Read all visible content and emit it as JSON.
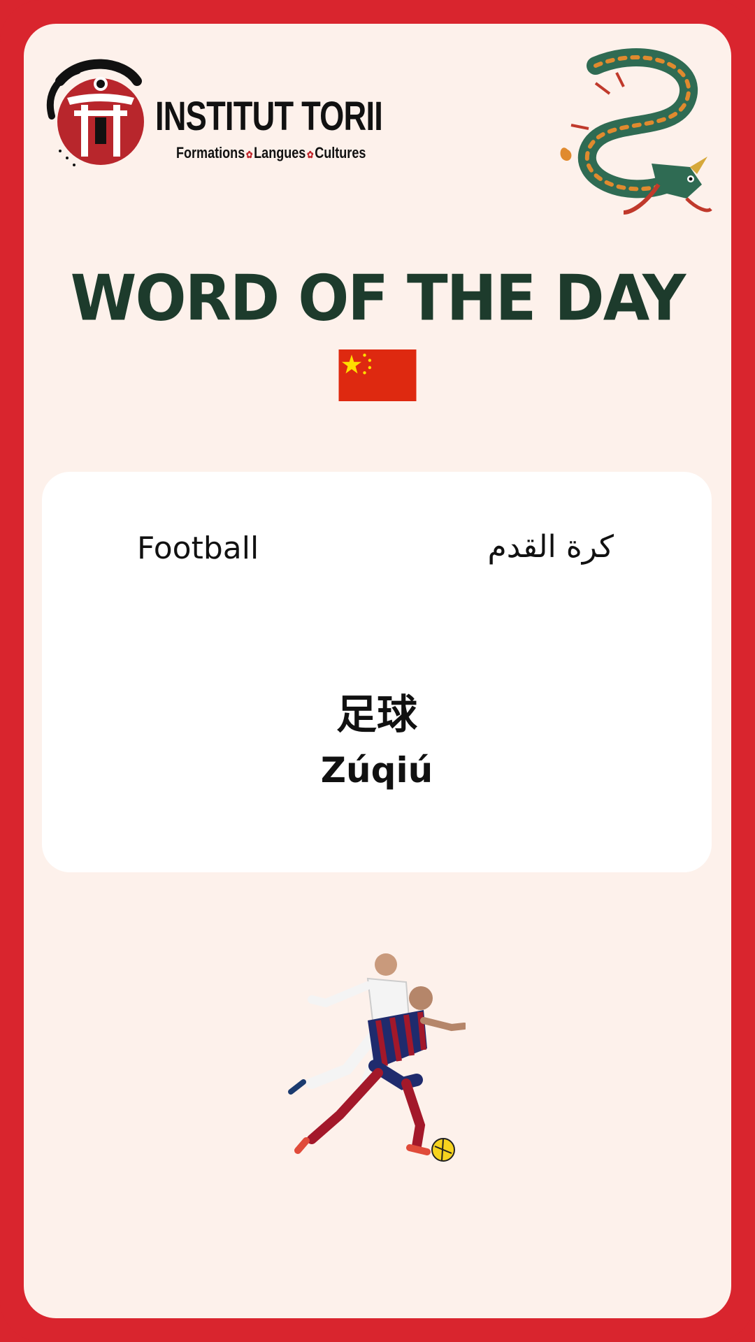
{
  "logo": {
    "title": "INSTITUT TORII",
    "subtitle_parts": [
      "Formations",
      "Langues",
      "Cultures"
    ]
  },
  "headline": "WORD OF THE DAY",
  "flag": "china-flag",
  "card": {
    "english": "Football",
    "arabic": "كرة القدم",
    "chinese": "足球",
    "pinyin": "Zúqiú"
  },
  "colors": {
    "frame": "#d9252e",
    "background": "#fdf1eb",
    "headline": "#1d3b2c",
    "card": "#ffffff"
  },
  "icons": {
    "logo": "torii-gate-logo",
    "dragon": "dragon-illustration",
    "players": "football-players-illustration"
  }
}
